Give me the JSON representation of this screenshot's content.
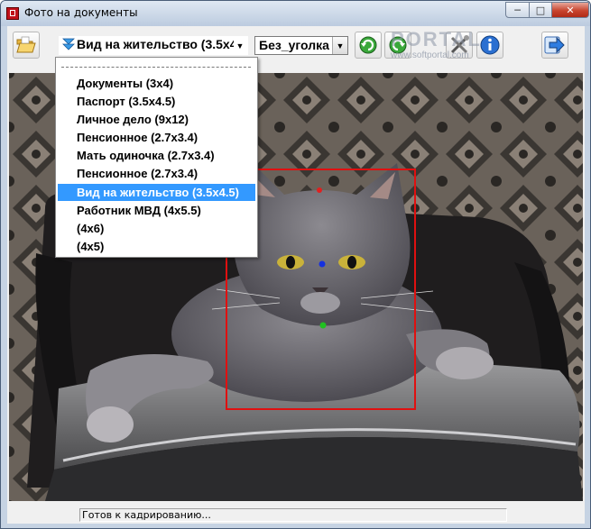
{
  "window": {
    "title": "Фото на документы",
    "min_glyph": "─",
    "max_glyph": "□",
    "close_glyph": "✕"
  },
  "toolbar": {
    "open_icon": "folder-open-icon",
    "doc_type_value": "Вид на жительство (3.5x4",
    "corner_value": "Без_уголка",
    "rotate_left_icon": "rotate-left-icon",
    "rotate_right_icon": "rotate-right-icon",
    "tools_icon": "tools-icon",
    "info_icon": "info-icon",
    "next_icon": "next-arrow-icon",
    "watermark": "PORTAL",
    "watermark_url": "www.softportal.com"
  },
  "doc_type_dropdown": {
    "items": [
      {
        "label": "Документы (3x4)",
        "selected": false
      },
      {
        "label": "Паспорт (3.5x4.5)",
        "selected": false
      },
      {
        "label": "Личное дело (9x12)",
        "selected": false
      },
      {
        "label": "Пенсионное (2.7x3.4)",
        "selected": false
      },
      {
        "label": "Мать одиночка (2.7x3.4)",
        "selected": false
      },
      {
        "label": "Пенсионное (2.7x3.4)",
        "selected": false
      },
      {
        "label": "Вид на жительство (3.5x4.5)",
        "selected": true
      },
      {
        "label": "Работник МВД (4x5.5)",
        "selected": false
      },
      {
        "label": "(4x6)",
        "selected": false
      },
      {
        "label": "(4x5)",
        "selected": false
      }
    ]
  },
  "status": {
    "text": "Готов к кадрированию..."
  },
  "colors": {
    "crop_frame": "#e01010",
    "marker_top": "#e02020",
    "marker_eyes": "#1530e0",
    "marker_chin": "#20c020",
    "selection": "#3399ff"
  }
}
